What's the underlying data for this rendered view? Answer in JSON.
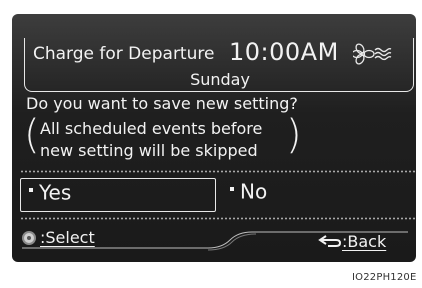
{
  "header": {
    "title": "Charge for Departure",
    "time": "10:00AM",
    "day": "Sunday",
    "fan_icon": "fan-icon"
  },
  "dialog": {
    "question": "Do you want to save new setting?",
    "note_line1": "All scheduled events before",
    "note_line2": "new setting will be skipped"
  },
  "options": {
    "yes_label": "Yes",
    "no_label": "No"
  },
  "footer": {
    "select_label": ":Select",
    "back_label": ":Back",
    "select_icon": "knob-icon",
    "back_icon": "back-arrow-icon"
  },
  "caption": "IO22PH120E",
  "colors": {
    "screen_bg": "#1f1f1f",
    "text": "#f2f2f2",
    "dots": "#a9a9a9"
  }
}
